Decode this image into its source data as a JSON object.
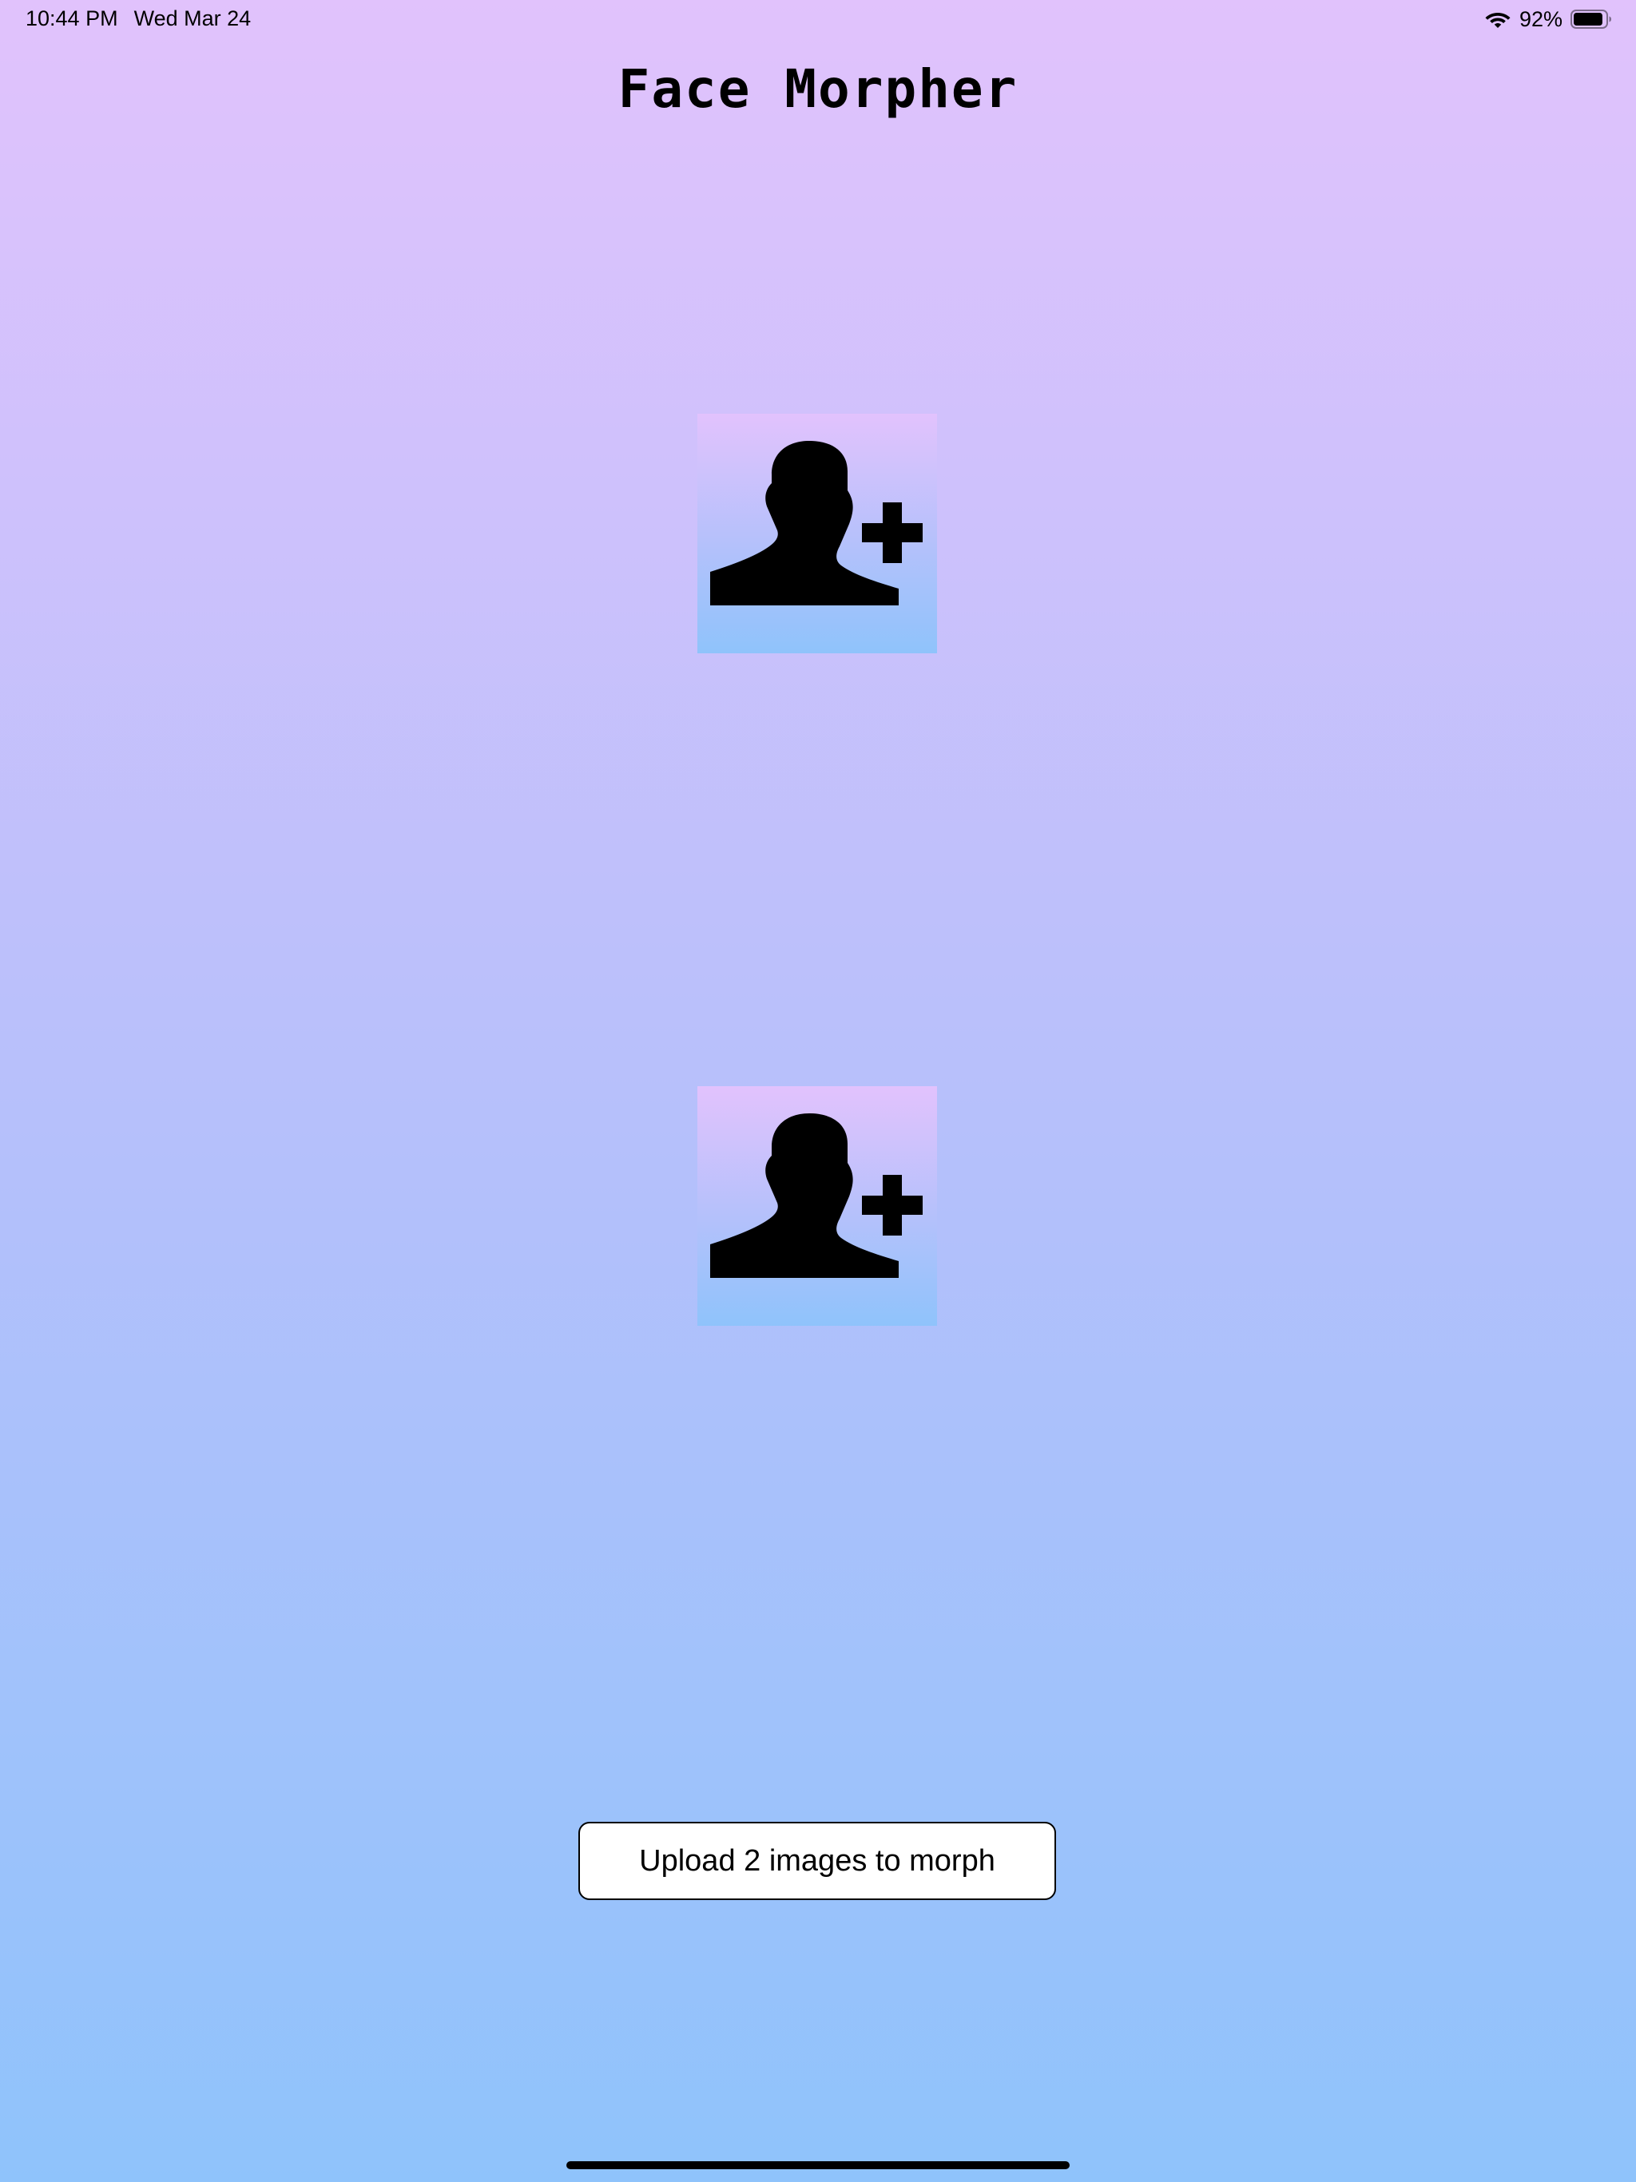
{
  "status_bar": {
    "time": "10:44 PM",
    "date": "Wed Mar 24",
    "battery_percent": "92%",
    "battery_level": 0.92,
    "icons": [
      "wifi-icon",
      "battery-icon"
    ]
  },
  "app": {
    "title": "Face Morpher"
  },
  "pickers": [
    {
      "icon": "add-person-icon"
    },
    {
      "icon": "add-person-icon"
    }
  ],
  "upload_button": {
    "label": "Upload 2 images to morph"
  },
  "colors": {
    "background_top": "#e1c2fc",
    "background_bottom": "#8fc3fb",
    "button_background": "#ffffff",
    "text": "#000000"
  }
}
